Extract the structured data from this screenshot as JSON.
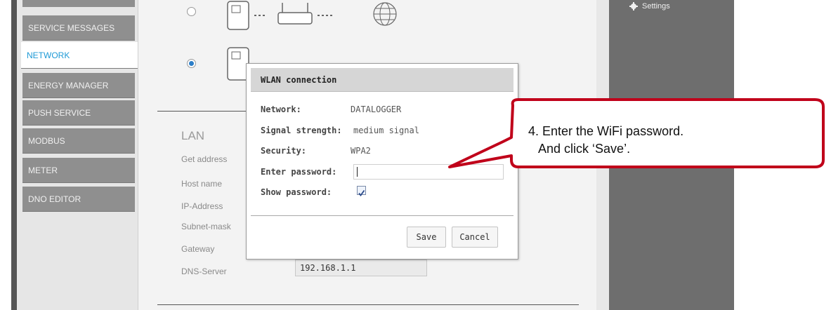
{
  "sidebar": {
    "items": [
      {
        "label": "SERVICE MESSAGES",
        "active": false
      },
      {
        "label": "NETWORK",
        "active": true
      },
      {
        "label": "ENERGY MANAGER",
        "active": false
      },
      {
        "label": "PUSH SERVICE",
        "active": false
      },
      {
        "label": "MODBUS",
        "active": false
      },
      {
        "label": "METER",
        "active": false
      },
      {
        "label": "DNO EDITOR",
        "active": false
      }
    ]
  },
  "header": {
    "settings_label": "Settings"
  },
  "lan": {
    "title": "LAN",
    "fields": [
      "Get address",
      "Host name",
      "IP-Address",
      "Subnet-mask",
      "Gateway",
      "DNS-Server"
    ],
    "dns_value": "192.168.1.1"
  },
  "dialog": {
    "title": "WLAN connection",
    "network_label": "Network:",
    "network_value": "DATALOGGER",
    "signal_label": "Signal strength:",
    "signal_value": "medium signal",
    "security_label": "Security:",
    "security_value": "WPA2",
    "password_label": "Enter password:",
    "password_value": "",
    "show_password_label": "Show password:",
    "show_password_checked": true,
    "save_label": "Save",
    "cancel_label": "Cancel"
  },
  "callout": {
    "line1": "4. Enter the WiFi password.",
    "line2": "   And click ‘Save’."
  },
  "colors": {
    "accent": "#1e9ad6",
    "callout_border": "#c0001a",
    "sidebar_item": "#8f8f8f"
  }
}
